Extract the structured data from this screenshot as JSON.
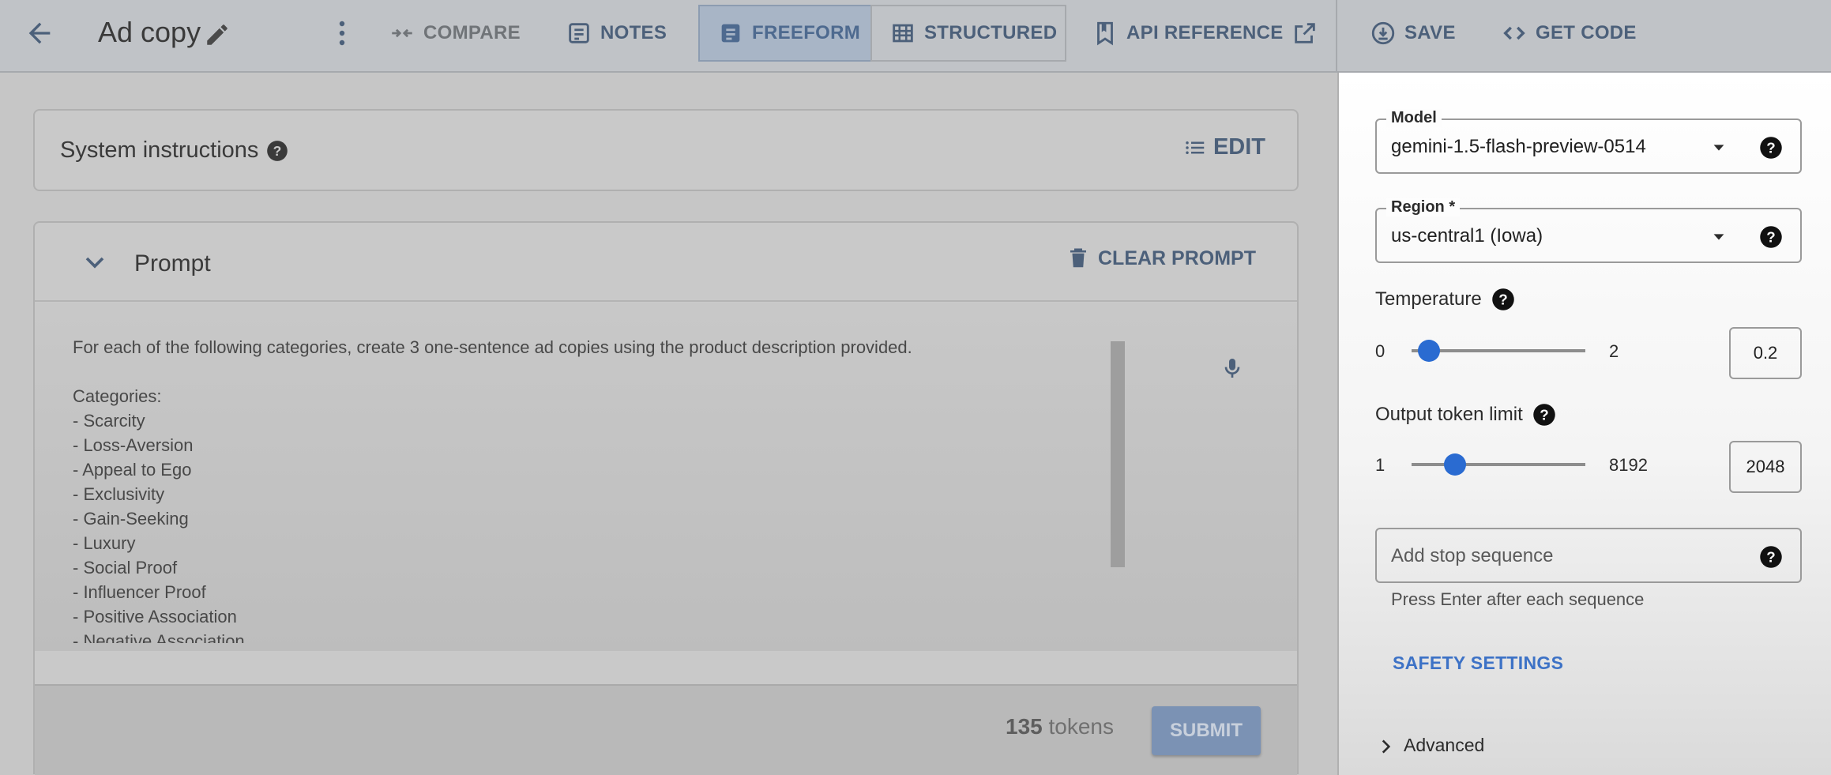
{
  "header": {
    "title": "Ad copy",
    "compare_label": "COMPARE",
    "notes_label": "NOTES",
    "freeform_label": "FREEFORM",
    "structured_label": "STRUCTURED",
    "api_reference_label": "API REFERENCE",
    "save_label": "SAVE",
    "get_code_label": "GET CODE"
  },
  "system_instructions": {
    "label": "System instructions",
    "edit_label": "EDIT"
  },
  "prompt": {
    "label": "Prompt",
    "clear_label": "CLEAR PROMPT",
    "lines": [
      "For each of the following categories, create 3 one-sentence ad copies using the product description provided.",
      "",
      "Categories:",
      "- Scarcity",
      "- Loss-Aversion",
      "- Appeal to Ego",
      "- Exclusivity",
      "- Gain-Seeking",
      "- Luxury",
      "- Social Proof",
      "- Influencer Proof",
      "- Positive Association",
      "- Negative Association"
    ],
    "token_count": "135",
    "token_suffix": "tokens",
    "submit_label": "SUBMIT"
  },
  "settings": {
    "model": {
      "label": "Model",
      "value": "gemini-1.5-flash-preview-0514"
    },
    "region": {
      "label": "Region *",
      "value": "us-central1 (Iowa)"
    },
    "temperature": {
      "label": "Temperature",
      "min": "0",
      "max": "2",
      "value": "0.2",
      "fraction": 0.1
    },
    "output_token_limit": {
      "label": "Output token limit",
      "min": "1",
      "max": "8192",
      "value": "2048",
      "fraction": 0.25
    },
    "stop_sequence": {
      "placeholder": "Add stop sequence",
      "hint": "Press Enter after each sequence"
    },
    "safety_label": "SAFETY SETTINGS",
    "advanced_label": "Advanced"
  },
  "colors": {
    "accent": "#2a6bd1",
    "link": "#3d72c6",
    "overlay_text_blue": "#4c607a"
  }
}
